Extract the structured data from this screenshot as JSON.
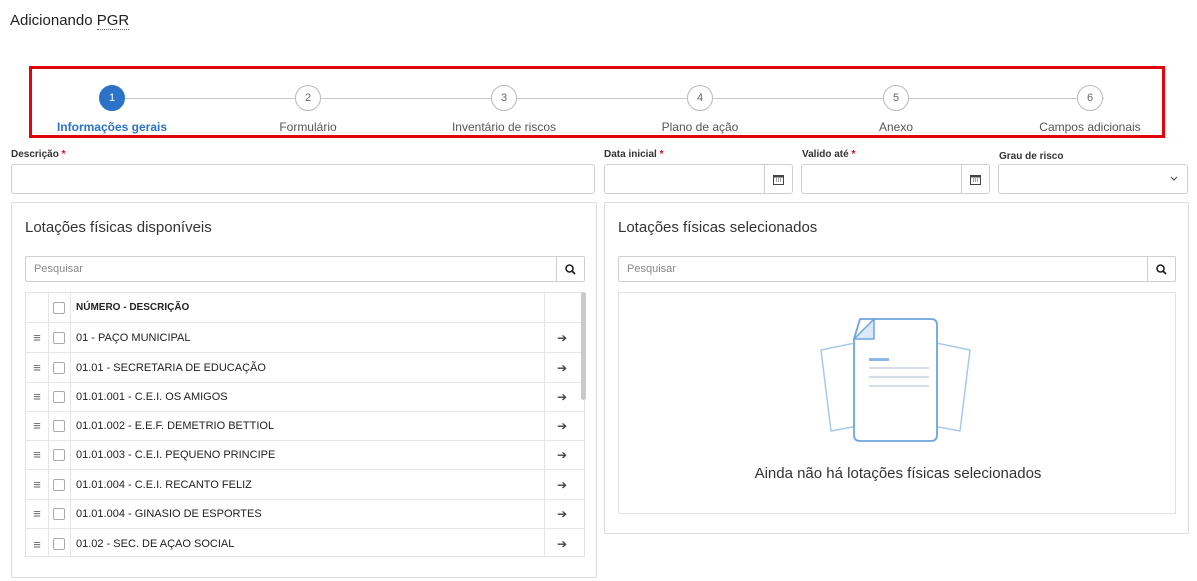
{
  "header": {
    "title_prefix": "Adicionando ",
    "title_entity": "PGR"
  },
  "stepper": {
    "steps": [
      {
        "number": "1",
        "label": "Informações gerais",
        "active": true
      },
      {
        "number": "2",
        "label": "Formulário",
        "active": false
      },
      {
        "number": "3",
        "label": "Inventário de riscos",
        "active": false
      },
      {
        "number": "4",
        "label": "Plano de ação",
        "active": false
      },
      {
        "number": "5",
        "label": "Anexo",
        "active": false
      },
      {
        "number": "6",
        "label": "Campos adicionais",
        "active": false
      }
    ],
    "highlight_color": "#e0040b",
    "active_color": "#2d72c9"
  },
  "form": {
    "descricao_label": "Descrição",
    "data_inicial_label": "Data inicial",
    "valido_ate_label": "Valido até",
    "grau_risco_label": "Grau de risco",
    "required_mark": "*",
    "descricao_value": "",
    "data_inicial_value": "",
    "valido_ate_value": "",
    "grau_risco_value": ""
  },
  "left_panel": {
    "title": "Lotações físicas disponíveis",
    "search_placeholder": "Pesquisar",
    "column_header": "NÚMERO - DESCRIÇÃO",
    "rows": [
      "01 - PAÇO MUNICIPAL",
      "01.01 - SECRETARIA DE EDUCAÇÃO",
      "01.01.001 - C.E.I. OS AMIGOS",
      "01.01.002 - E.E.F. DEMETRIO BETTIOL",
      "01.01.003 - C.E.I. PEQUENO PRINCIPE",
      "01.01.004 - C.E.I. RECANTO FELIZ",
      "01.01.004 - GINASIO DE ESPORTES",
      "01.02 - SEC. DE AÇAO SOCIAL"
    ]
  },
  "right_panel": {
    "title": "Lotações físicas selecionados",
    "search_placeholder": "Pesquisar",
    "empty_message": "Ainda não há lotações físicas selecionados"
  }
}
